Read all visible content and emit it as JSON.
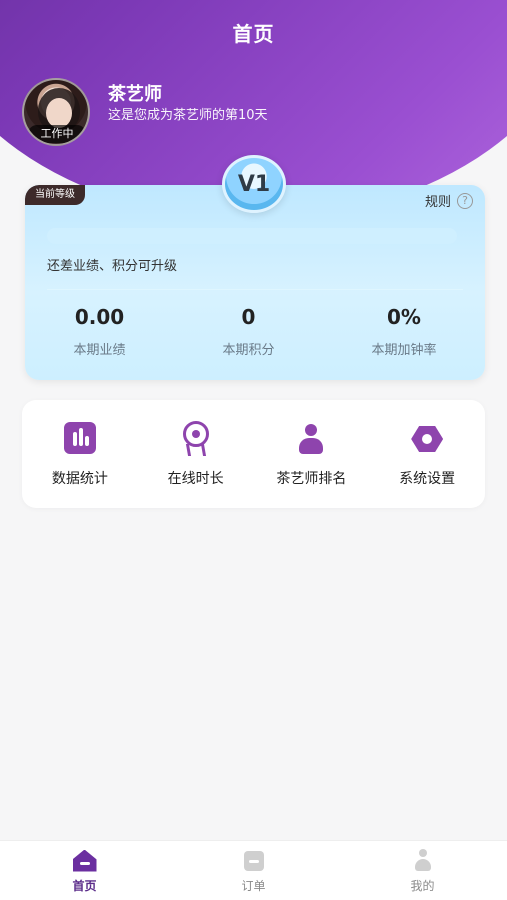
{
  "header": {
    "title": "首页"
  },
  "profile": {
    "name": "茶艺师",
    "subtitle": "这是您成为茶艺师的第10天",
    "status_badge": "工作中"
  },
  "level_card": {
    "tag": "当前等级",
    "level": "V1",
    "rules": "规则",
    "hint": "还差业绩、积分可升级",
    "progress": 0,
    "stats": [
      {
        "value": "0.00",
        "label": "本期业绩"
      },
      {
        "value": "0",
        "label": "本期积分"
      },
      {
        "value": "0%",
        "label": "本期加钟率"
      }
    ]
  },
  "shortcuts": [
    {
      "label": "数据统计",
      "icon": "stats-icon"
    },
    {
      "label": "在线时长",
      "icon": "award-icon"
    },
    {
      "label": "茶艺师排名",
      "icon": "person-icon"
    },
    {
      "label": "系统设置",
      "icon": "settings-hex-icon"
    }
  ],
  "bottom_nav": [
    {
      "label": "首页",
      "icon": "home-icon",
      "active": true
    },
    {
      "label": "订单",
      "icon": "orders-icon",
      "active": false
    },
    {
      "label": "我的",
      "icon": "profile-icon",
      "active": false
    }
  ],
  "colors": {
    "accent_purple": "#8e44ad",
    "card_blue": "#bfe8ff"
  }
}
